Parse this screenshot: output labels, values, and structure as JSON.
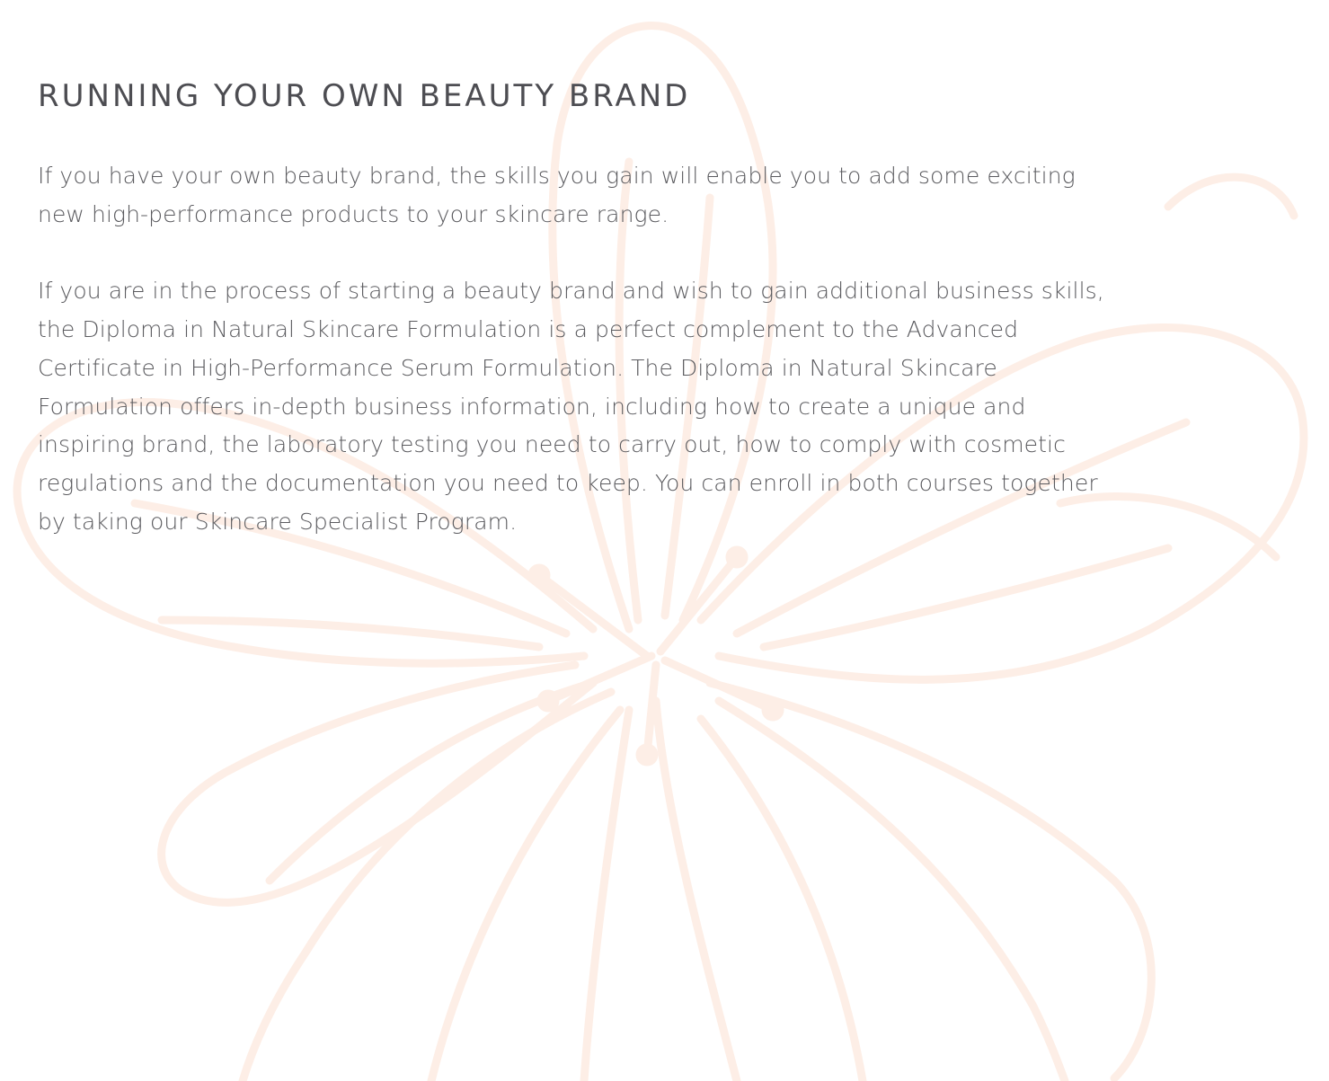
{
  "section": {
    "title": "RUNNING YOUR OWN BEAUTY BRAND",
    "paragraphs": [
      "If you have your own beauty brand, the skills you gain will enable you to add some exciting new high-performance products to your skincare range.",
      "If you are in the process of starting a beauty brand and wish to gain additional business skills, the Diploma in Natural Skincare Formulation is a perfect complement to the Advanced Certificate in High-Performance Serum Formulation. The Diploma in Natural Skincare Formulation offers in-depth business information, including how to create a unique and inspiring brand, the laboratory testing you need to carry out, how to comply with cosmetic regulations and the documentation you need to keep. You can enroll in both courses together by taking our Skincare Specialist Program."
    ]
  },
  "background": {
    "icon": "flower-line-art-icon",
    "stroke_color": "#fdeee6"
  },
  "colors": {
    "heading": "#4d4d52",
    "body_text": "#5b5b5f",
    "background": "#ffffff"
  }
}
